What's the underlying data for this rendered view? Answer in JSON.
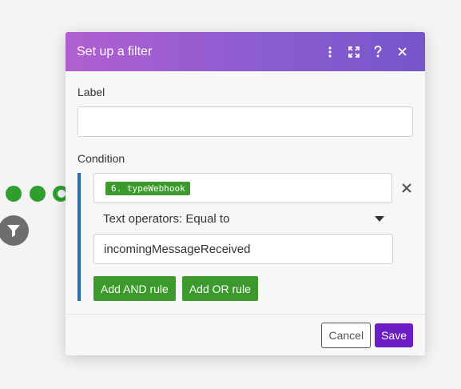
{
  "modal": {
    "title": "Set up a filter",
    "header_icons": [
      "more-vertical-icon",
      "expand-icon",
      "help-icon",
      "close-icon"
    ]
  },
  "label_field": {
    "label": "Label",
    "value": ""
  },
  "condition": {
    "label": "Condition",
    "variable_pill": "6. typeWebhook",
    "operator": "Text operators: Equal to",
    "value": "incomingMessageReceived",
    "add_and_label": "Add AND rule",
    "add_or_label": "Add OR rule"
  },
  "footer": {
    "cancel_label": "Cancel",
    "save_label": "Save"
  },
  "colors": {
    "header_gradient_start": "#b15fd0",
    "header_gradient_end": "#7656c9",
    "accent_green": "#3b9a2b",
    "save_purple": "#6d1dc4",
    "condition_border": "#1e6fb8"
  }
}
